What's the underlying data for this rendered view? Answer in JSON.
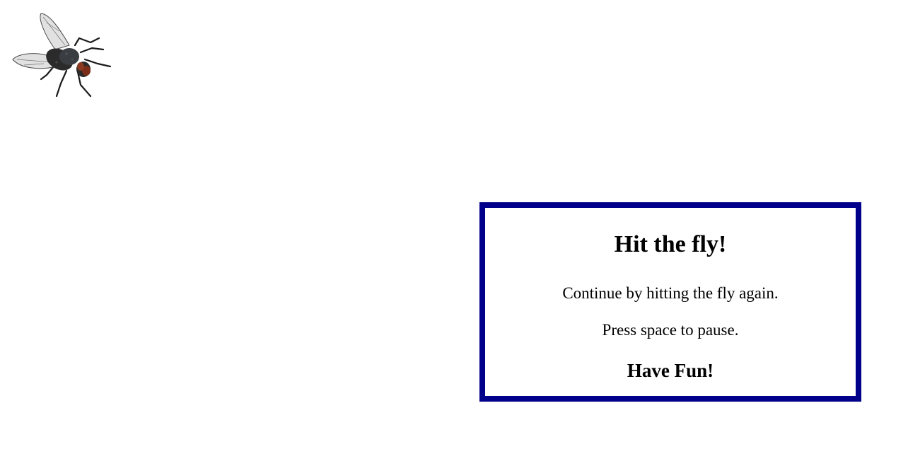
{
  "game": {
    "fly_icon": "fly-icon"
  },
  "dialog": {
    "title": "Hit the fly!",
    "line1": "Continue by hitting the fly again.",
    "line2": "Press space to pause.",
    "footer": "Have Fun!"
  },
  "colors": {
    "dialog_border": "#00008b",
    "background": "#ffffff"
  }
}
